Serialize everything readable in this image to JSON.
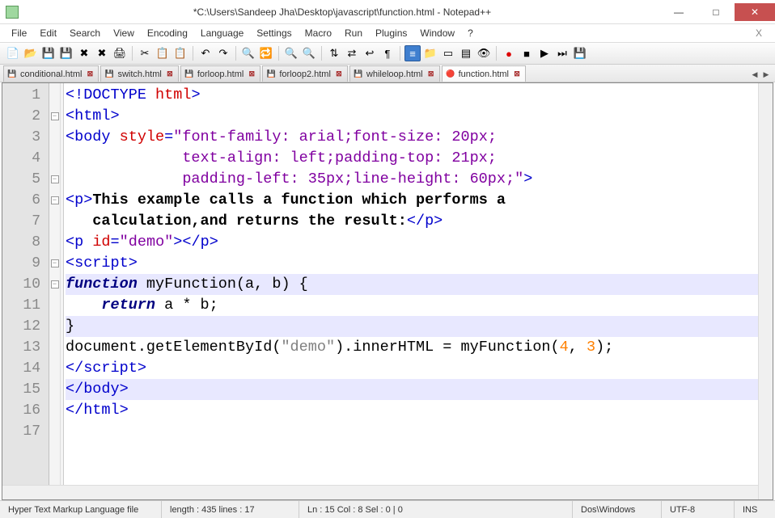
{
  "window": {
    "title": "*C:\\Users\\Sandeep Jha\\Desktop\\javascript\\function.html - Notepad++"
  },
  "menu": {
    "items": [
      "File",
      "Edit",
      "Search",
      "View",
      "Encoding",
      "Language",
      "Settings",
      "Macro",
      "Run",
      "Plugins",
      "Window",
      "?"
    ],
    "close_x": "X"
  },
  "tabs": {
    "items": [
      {
        "label": "conditional.html",
        "modified": false,
        "active": false
      },
      {
        "label": "switch.html",
        "modified": false,
        "active": false
      },
      {
        "label": "forloop.html",
        "modified": false,
        "active": false
      },
      {
        "label": "forloop2.html",
        "modified": false,
        "active": false
      },
      {
        "label": "whileloop.html",
        "modified": false,
        "active": false
      },
      {
        "label": "function.html",
        "modified": true,
        "active": true
      }
    ]
  },
  "editor": {
    "lines": [
      {
        "n": "1",
        "fold": "",
        "tokens": [
          {
            "c": "c-tag",
            "t": "<!"
          },
          {
            "c": "c-tag",
            "t": "DOCTYPE"
          },
          {
            "c": "c-pl",
            "t": " "
          },
          {
            "c": "c-attr",
            "t": "html"
          },
          {
            "c": "c-tag",
            "t": ">"
          }
        ]
      },
      {
        "n": "2",
        "fold": "minus",
        "tokens": [
          {
            "c": "c-tag",
            "t": "<html>"
          }
        ]
      },
      {
        "n": "3",
        "fold": "",
        "tokens": [
          {
            "c": "c-tag",
            "t": "<body"
          },
          {
            "c": "c-pl",
            "t": " "
          },
          {
            "c": "c-attr",
            "t": "style"
          },
          {
            "c": "c-tag",
            "t": "="
          },
          {
            "c": "c-str",
            "t": "\"font-family: arial;font-size: 20px;"
          }
        ]
      },
      {
        "n": "4",
        "fold": "",
        "tokens": [
          {
            "c": "c-str",
            "t": "             text-align: left;padding-top: 21px;"
          }
        ]
      },
      {
        "n": "5",
        "fold": "minus",
        "tokens": [
          {
            "c": "c-str",
            "t": "             padding-left: 35px;line-height: 60px;\""
          },
          {
            "c": "c-tag",
            "t": ">"
          }
        ]
      },
      {
        "n": "6",
        "fold": "minus",
        "tokens": [
          {
            "c": "c-tag",
            "t": "<p>"
          },
          {
            "c": "c-text",
            "t": "This example calls a function which performs a"
          }
        ]
      },
      {
        "n": "7",
        "fold": "",
        "tokens": [
          {
            "c": "c-text",
            "t": "   calculation,and returns the result:"
          },
          {
            "c": "c-tag",
            "t": "</p>"
          }
        ]
      },
      {
        "n": "8",
        "fold": "",
        "tokens": [
          {
            "c": "c-tag",
            "t": "<p"
          },
          {
            "c": "c-pl",
            "t": " "
          },
          {
            "c": "c-attr",
            "t": "id"
          },
          {
            "c": "c-tag",
            "t": "="
          },
          {
            "c": "c-str",
            "t": "\"demo\""
          },
          {
            "c": "c-tag",
            "t": "></p>"
          }
        ]
      },
      {
        "n": "9",
        "fold": "minus",
        "tokens": [
          {
            "c": "c-tag",
            "t": "<script>"
          }
        ]
      },
      {
        "n": "10",
        "fold": "minus",
        "hl": true,
        "tokens": [
          {
            "c": "c-kwd",
            "t": "function"
          },
          {
            "c": "c-pl",
            "t": " myFunction(a, b) {"
          }
        ]
      },
      {
        "n": "11",
        "fold": "",
        "tokens": [
          {
            "c": "c-pl",
            "t": "    "
          },
          {
            "c": "c-kwd",
            "t": "return"
          },
          {
            "c": "c-pl",
            "t": " a * b;"
          }
        ]
      },
      {
        "n": "12",
        "fold": "",
        "hl": true,
        "tokens": [
          {
            "c": "c-pl",
            "t": "}"
          }
        ]
      },
      {
        "n": "13",
        "fold": "",
        "tokens": [
          {
            "c": "c-pl",
            "t": "document.getElementById("
          },
          {
            "c": "c-strg",
            "t": "\"demo\""
          },
          {
            "c": "c-pl",
            "t": ").innerHTML = myFunction("
          },
          {
            "c": "c-num",
            "t": "4"
          },
          {
            "c": "c-pl",
            "t": ", "
          },
          {
            "c": "c-num",
            "t": "3"
          },
          {
            "c": "c-pl",
            "t": ");"
          }
        ]
      },
      {
        "n": "14",
        "fold": "",
        "tokens": [
          {
            "c": "c-tag",
            "t": "</script>"
          }
        ]
      },
      {
        "n": "15",
        "fold": "",
        "hl": true,
        "tokens": [
          {
            "c": "c-tag",
            "t": "</body>"
          }
        ]
      },
      {
        "n": "16",
        "fold": "",
        "tokens": [
          {
            "c": "c-tag",
            "t": "</html>"
          }
        ]
      },
      {
        "n": "17",
        "fold": "",
        "tokens": []
      }
    ]
  },
  "statusbar": {
    "lang": "Hyper Text Markup Language file",
    "len": "length : 435    lines : 17",
    "pos": "Ln : 15    Col : 8    Sel : 0 | 0",
    "eol": "Dos\\Windows",
    "enc": "UTF-8",
    "mode": "INS"
  },
  "icons": {
    "min": "—",
    "max": "□",
    "close": "✕",
    "left": "◀",
    "right": "▶"
  }
}
